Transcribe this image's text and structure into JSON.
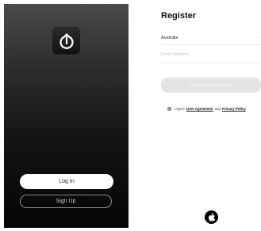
{
  "login_screen": {
    "logo_icon": "power-arrow-up-icon",
    "login_label": "Log In",
    "signup_label": "Sign Up"
  },
  "register_screen": {
    "title": "Register",
    "country": "Australia",
    "country_chevron": "›",
    "email_placeholder": "Email Address",
    "verify_button_label": "Get Verification Code",
    "agree_prefix": "I Agree",
    "user_agreement_link": "User Agreement",
    "agree_and": "and",
    "privacy_policy_link": "Privacy Policy",
    "apple_icon": "apple-icon"
  },
  "colors": {
    "dark_bg": "#141414",
    "disabled_button": "#e3e3e3"
  }
}
